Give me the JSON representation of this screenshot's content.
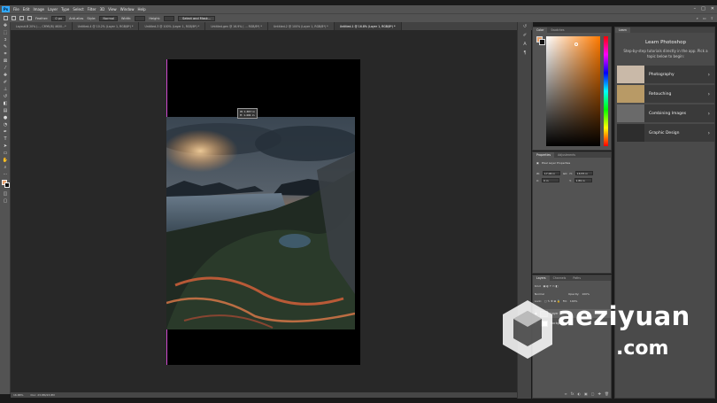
{
  "app": {
    "logo": "Ps"
  },
  "menu": [
    "File",
    "Edit",
    "Image",
    "Layer",
    "Type",
    "Select",
    "Filter",
    "3D",
    "View",
    "Window",
    "Help"
  ],
  "window_controls": [
    "–",
    "□",
    "✕"
  ],
  "options": {
    "feather_label": "Feather:",
    "feather_value": "0 px",
    "antialias_label": "Anti-alias",
    "style_label": "Style:",
    "style_value": "Normal",
    "width_label": "Width:",
    "height_label": "Height:",
    "select_mask_label": "Select and Mask..."
  },
  "tabs": [
    {
      "label": "Layout-B 20% (..., CMYK/8) 4K00...*"
    },
    {
      "label": "Untitled-4 @ 10.2% (Layer 1, RGB/8*) *"
    },
    {
      "label": "Untitled-3 @ 100% (Layer 1, RGB/8*) *"
    },
    {
      "label": "Untitled-gen @ 16.9% ( ... RGB/8*) *"
    },
    {
      "label": "Untitled-2 @ 100% (Layer 1, RGB/8*) *"
    },
    {
      "label": "Untitled-1 @ 16.8% (Layer 1, RGB/8*) *"
    }
  ],
  "hud": {
    "w": "W: 1.657 in",
    "h": "H: 1.491 in"
  },
  "status": {
    "zoom": "16.88%",
    "doc": "Doc: 23.8M/23.8M"
  },
  "color_panel": {
    "tab_color": "Color",
    "tab_swatches": "Swatches"
  },
  "properties": {
    "tab_props": "Properties",
    "tab_adjust": "Adjustments",
    "heading": "Pixel Layer Properties",
    "w_label": "W:",
    "w_value": "17.06 in",
    "h_label": "H:",
    "h_value": "16.55 in",
    "x_label": "X:",
    "x_value": "0 in",
    "y_label": "Y:",
    "y_value": "1.89 in",
    "link": "GO"
  },
  "layers": {
    "tab_layers": "Layers",
    "tab_channels": "Channels",
    "tab_paths": "Paths",
    "kind": "Kind",
    "blend": "Normal",
    "opacity_label": "Opacity:",
    "opacity_value": "100%",
    "lock_label": "Lock:",
    "fill_label": "Fill:",
    "fill_value": "100%",
    "items": [
      {
        "name": "Layer 1"
      },
      {
        "name": "Background"
      }
    ],
    "footer_icons": [
      "∞",
      "fx",
      "◐",
      "▣",
      "▢",
      "✚",
      "🗑"
    ]
  },
  "learn": {
    "tab": "Learn",
    "title": "Learn Photoshop",
    "subtitle": "Step-by-step tutorials directly in the app. Pick a topic below to begin:",
    "topics": [
      {
        "label": "Photography",
        "thumb": "#c9b9a8"
      },
      {
        "label": "Retouching",
        "thumb": "#b89a66"
      },
      {
        "label": "Combining Images",
        "thumb": "#6a6a6a"
      },
      {
        "label": "Graphic Design",
        "thumb": "#2d2d2d"
      }
    ]
  },
  "watermark": {
    "text": "aeziyuan",
    "domain": ".com"
  }
}
